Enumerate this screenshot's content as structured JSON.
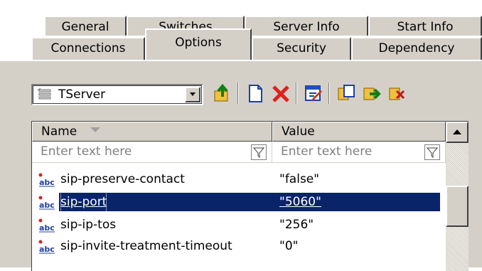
{
  "tabs": {
    "row1": [
      "General",
      "Switches",
      "Server Info",
      "Start Info"
    ],
    "row2": [
      "Connections",
      "Options",
      "Security",
      "Dependency"
    ],
    "selected": "Options"
  },
  "toolbar": {
    "combo_value": "TServer",
    "buttons": [
      "up-folder-icon",
      "new-page-icon",
      "delete-icon",
      "edit-icon",
      "copy-icon",
      "paste-icon",
      "export-icon"
    ]
  },
  "grid": {
    "columns": [
      "Name",
      "Value"
    ],
    "filter_placeholder_name": "Enter text here",
    "filter_placeholder_value": "Enter text here",
    "rows": [
      {
        "name": "sip-preserve-contact",
        "value": "\"false\"",
        "selected": false
      },
      {
        "name": "sip-port",
        "value": "\"5060\"",
        "selected": true
      },
      {
        "name": "sip-ip-tos",
        "value": "\"256\"",
        "selected": false
      },
      {
        "name": "sip-invite-treatment-timeout",
        "value": "\"0\"",
        "selected": false
      }
    ]
  },
  "colors": {
    "face": "#d4d0c8",
    "selection": "#0a246a",
    "delete_red": "#e0201c",
    "funnel": "#808080"
  }
}
